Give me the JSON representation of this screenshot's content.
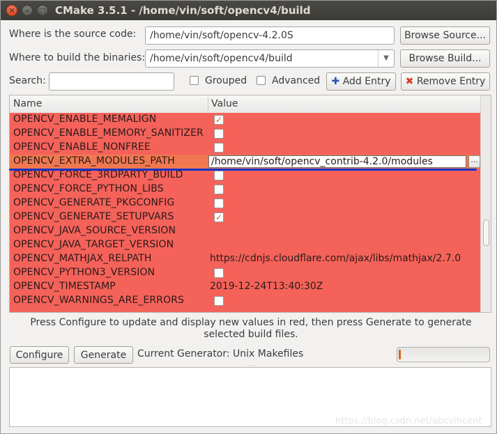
{
  "window": {
    "title": "CMake 3.5.1 - /home/vin/soft/opencv4/build"
  },
  "paths": {
    "source_label": "Where is the source code:",
    "source_value": "/home/vin/soft/opencv-4.2.0S",
    "browse_source": "Browse Source...",
    "build_label": "Where to build the binaries:",
    "build_value": "/home/vin/soft/opencv4/build",
    "browse_build": "Browse Build..."
  },
  "toolbar": {
    "search_label": "Search:",
    "search_value": "",
    "grouped_label": "Grouped",
    "grouped_checked": false,
    "advanced_label": "Advanced",
    "advanced_checked": false,
    "add_entry": "Add Entry",
    "remove_entry": "Remove Entry"
  },
  "table": {
    "columns": [
      "Name",
      "Value"
    ],
    "rows": [
      {
        "name": "OPENCV_ENABLE_MEMALIGN",
        "type": "bool",
        "checked": true
      },
      {
        "name": "OPENCV_ENABLE_MEMORY_SANITIZER",
        "type": "bool",
        "checked": false
      },
      {
        "name": "OPENCV_ENABLE_NONFREE",
        "type": "bool",
        "checked": false
      },
      {
        "name": "OPENCV_EXTRA_MODULES_PATH",
        "type": "edit",
        "value": "/home/vin/soft/opencv_contrib-4.2.0/modules",
        "button": "..."
      },
      {
        "name": "OPENCV_FORCE_3RDPARTY_BUILD",
        "type": "bool",
        "checked": false
      },
      {
        "name": "OPENCV_FORCE_PYTHON_LIBS",
        "type": "bool",
        "checked": false
      },
      {
        "name": "OPENCV_GENERATE_PKGCONFIG",
        "type": "bool",
        "checked": false
      },
      {
        "name": "OPENCV_GENERATE_SETUPVARS",
        "type": "bool",
        "checked": true
      },
      {
        "name": "OPENCV_JAVA_SOURCE_VERSION",
        "type": "text",
        "value": ""
      },
      {
        "name": "OPENCV_JAVA_TARGET_VERSION",
        "type": "text",
        "value": ""
      },
      {
        "name": "OPENCV_MATHJAX_RELPATH",
        "type": "text",
        "value": "https://cdnjs.cloudflare.com/ajax/libs/mathjax/2.7.0"
      },
      {
        "name": "OPENCV_PYTHON3_VERSION",
        "type": "bool",
        "checked": false
      },
      {
        "name": "OPENCV_TIMESTAMP",
        "type": "text",
        "value": "2019-12-24T13:40:30Z"
      },
      {
        "name": "OPENCV_WARNINGS_ARE_ERRORS",
        "type": "bool",
        "checked": false
      }
    ]
  },
  "help_text": "Press Configure to update and display new values in red, then press Generate to generate selected build files.",
  "actions": {
    "configure": "Configure",
    "generate": "Generate",
    "generator_text": "Current Generator: Unix Makefiles",
    "progress": 0.02
  },
  "watermark": "https://blog.csdn.net/abcvincent",
  "colors": {
    "changed_row": "#f4625a",
    "selected_row": "#f07850",
    "annotation_line": "#1333c9",
    "check_mark": "#e05a10"
  }
}
